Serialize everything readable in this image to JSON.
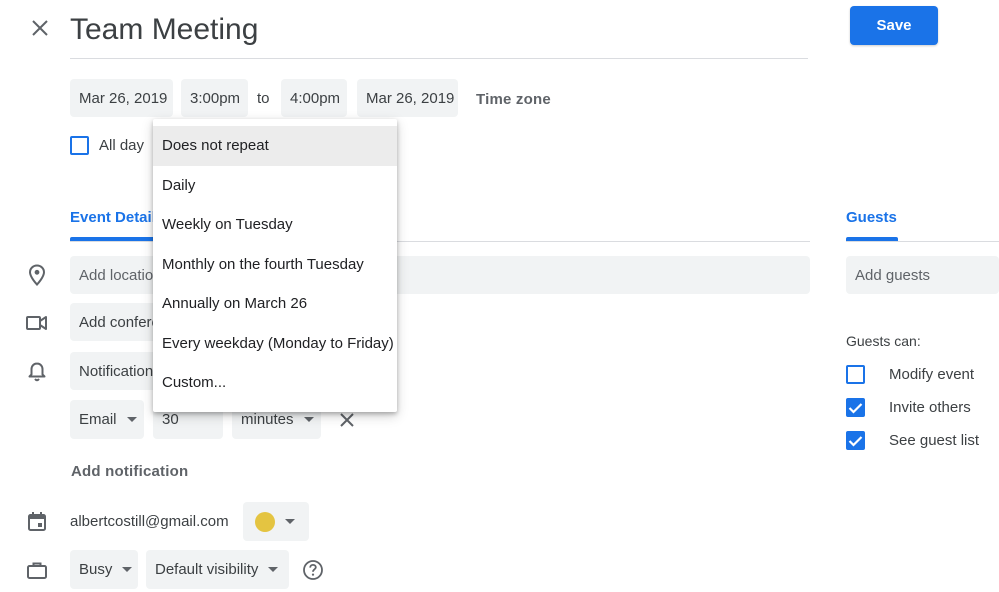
{
  "header": {
    "title": "Team Meeting",
    "save_label": "Save"
  },
  "datetime": {
    "start_date": "Mar 26, 2019",
    "start_time": "3:00pm",
    "to_label": "to",
    "end_time": "4:00pm",
    "end_date": "Mar 26, 2019",
    "timezone_label": "Time zone",
    "all_day_label": "All day",
    "all_day_checked": false
  },
  "repeat_menu": {
    "selected_index": 0,
    "items": [
      "Does not repeat",
      "Daily",
      "Weekly on Tuesday",
      "Monthly on the fourth Tuesday",
      "Annually on March 26",
      "Every weekday (Monday to Friday)",
      "Custom..."
    ]
  },
  "tabs": {
    "details_label": "Event Details",
    "guests_label": "Guests"
  },
  "details": {
    "location_placeholder": "Add location",
    "conference_label": "Add conferencing",
    "notification_label": "Notification",
    "notification_method": "Email",
    "notification_value": "30",
    "notification_unit": "minutes",
    "add_notification_label": "Add notification",
    "calendar_owner": "albertcostill@gmail.com",
    "calendar_color": "#e4c441",
    "availability": "Busy",
    "visibility": "Default visibility"
  },
  "guests": {
    "add_placeholder": "Add guests",
    "permissions_title": "Guests can:",
    "permissions": [
      {
        "label": "Modify event",
        "checked": false
      },
      {
        "label": "Invite others",
        "checked": true
      },
      {
        "label": "See guest list",
        "checked": true
      }
    ]
  },
  "colors": {
    "accent": "#1a73e8",
    "field_bg": "#f1f3f4",
    "text": "#3c4043",
    "muted": "#5f6368"
  }
}
